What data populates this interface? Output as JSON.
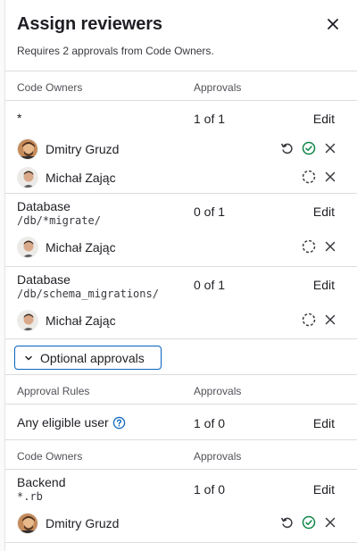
{
  "panel": {
    "title": "Assign reviewers",
    "subtitle": "Requires 2 approvals from Code Owners."
  },
  "headers": {
    "code_owners": "Code Owners",
    "approvals": "Approvals",
    "approval_rules": "Approval Rules"
  },
  "rules": [
    {
      "name": "*",
      "path": "",
      "approvals": "1 of 1",
      "edit": "Edit",
      "reviewers": [
        {
          "name": "Dmitry Gruzd",
          "avatar": "dmitry",
          "status": "approved"
        },
        {
          "name": "Michał Zając",
          "avatar": "michal",
          "status": "pending"
        }
      ]
    },
    {
      "name": "Database",
      "path": "/db/*migrate/",
      "approvals": "0 of 1",
      "edit": "Edit",
      "reviewers": [
        {
          "name": "Michał Zając",
          "avatar": "michal",
          "status": "pending"
        }
      ]
    },
    {
      "name": "Database",
      "path": "/db/schema_migrations/",
      "approvals": "0 of 1",
      "edit": "Edit",
      "reviewers": [
        {
          "name": "Michał Zając",
          "avatar": "michal",
          "status": "pending"
        }
      ]
    }
  ],
  "optional": {
    "toggle_label": "Optional approvals",
    "any_eligible": {
      "name": "Any eligible user",
      "approvals": "1 of 0",
      "edit": "Edit"
    },
    "backend": {
      "name": "Backend",
      "path": "*.rb",
      "approvals": "1 of 0",
      "edit": "Edit",
      "reviewers": [
        {
          "name": "Dmitry Gruzd",
          "avatar": "dmitry",
          "status": "approved"
        }
      ]
    }
  },
  "icons": {
    "close": "close-icon",
    "undo": "undo-icon",
    "approved": "check-circle-icon",
    "pending": "dashed-circle-icon",
    "remove": "remove-icon",
    "chevron": "chevron-down-icon",
    "help": "question-circle-icon"
  },
  "colors": {
    "approved_green": "#108548",
    "accent_blue": "#1068bf",
    "border": "#dcdcde"
  }
}
